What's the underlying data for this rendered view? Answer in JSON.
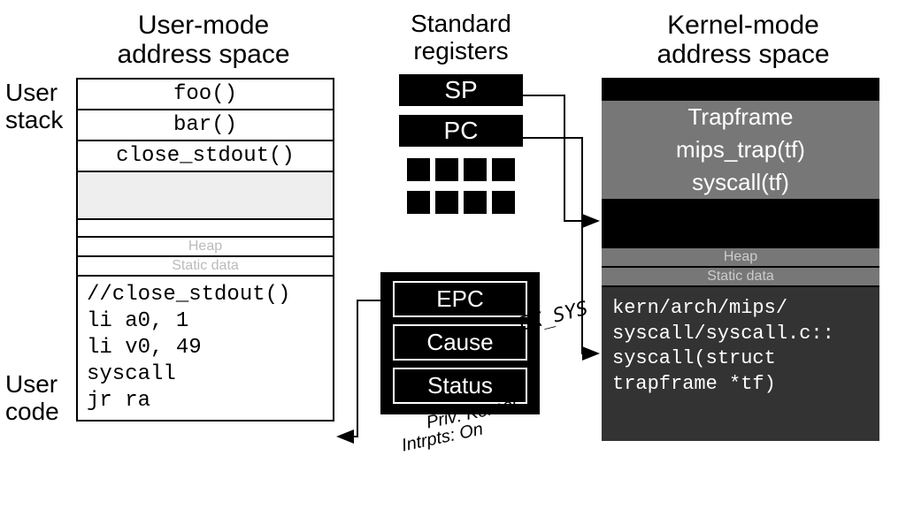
{
  "titles": {
    "user": "User-mode\naddress space",
    "kernel": "Kernel-mode\naddress space",
    "registers": "Standard\nregisters"
  },
  "sidelabels": {
    "stack": "User\nstack",
    "code": "User\ncode"
  },
  "user_stack": [
    "foo()",
    "bar()",
    "close_stdout()"
  ],
  "user_mem": {
    "heap": "Heap",
    "static": "Static data"
  },
  "user_code": "//close_stdout()\nli a0, 1\nli v0, 49\nsyscall\njr ra",
  "std_regs": [
    "SP",
    "PC"
  ],
  "special_regs": [
    "EPC",
    "Cause",
    "Status"
  ],
  "annotations": {
    "cause_val": "EX_SYS",
    "status_priv": "Priv: Kernel",
    "status_intr": "Intrpts: On"
  },
  "kernel_stack": [
    "Trapframe",
    "mips_trap(tf)",
    "syscall(tf)"
  ],
  "kernel_mem": {
    "heap": "Heap",
    "static": "Static data"
  },
  "kernel_code": "kern/arch/mips/\nsyscall/syscall.c::\nsyscall(struct\ntrapframe *tf)"
}
